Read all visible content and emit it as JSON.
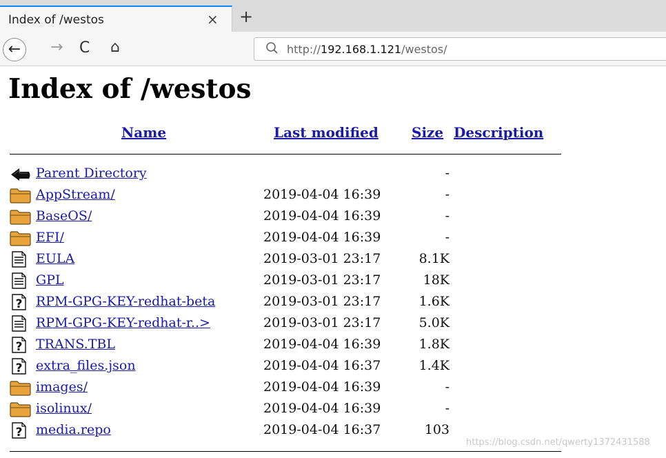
{
  "browser": {
    "tab_title": "Index of /westos",
    "tab_close": "×",
    "new_tab": "+",
    "back": "←",
    "forward": "→",
    "reload": "C",
    "home": "⌂",
    "url_prefix": "http://",
    "url_host": "192.168.1.121",
    "url_path": "/westos/"
  },
  "page": {
    "title": "Index of /westos",
    "columns": [
      "Name",
      "Last modified",
      "Size",
      "Description"
    ],
    "rows": [
      {
        "icon": "back-arrow-icon",
        "name": "Parent Directory",
        "modified": "",
        "size": "-"
      },
      {
        "icon": "folder-icon",
        "name": "AppStream/",
        "modified": "2019-04-04 16:39",
        "size": "-"
      },
      {
        "icon": "folder-icon",
        "name": "BaseOS/",
        "modified": "2019-04-04 16:39",
        "size": "-"
      },
      {
        "icon": "folder-icon",
        "name": "EFI/",
        "modified": "2019-04-04 16:39",
        "size": "-"
      },
      {
        "icon": "text-file-icon",
        "name": "EULA",
        "modified": "2019-03-01 23:17",
        "size": "8.1K"
      },
      {
        "icon": "text-file-icon",
        "name": "GPL",
        "modified": "2019-03-01 23:17",
        "size": "18K"
      },
      {
        "icon": "unknown-file-icon",
        "name": "RPM-GPG-KEY-redhat-beta",
        "modified": "2019-03-01 23:17",
        "size": "1.6K"
      },
      {
        "icon": "text-file-icon",
        "name": "RPM-GPG-KEY-redhat-r..>",
        "modified": "2019-03-01 23:17",
        "size": "5.0K"
      },
      {
        "icon": "unknown-file-icon",
        "name": "TRANS.TBL",
        "modified": "2019-04-04 16:39",
        "size": "1.8K"
      },
      {
        "icon": "unknown-file-icon",
        "name": "extra_files.json",
        "modified": "2019-04-04 16:37",
        "size": "1.4K"
      },
      {
        "icon": "folder-icon",
        "name": "images/",
        "modified": "2019-04-04 16:39",
        "size": "-"
      },
      {
        "icon": "folder-icon",
        "name": "isolinux/",
        "modified": "2019-04-04 16:39",
        "size": "-"
      },
      {
        "icon": "unknown-file-icon",
        "name": "media.repo",
        "modified": "2019-04-04 16:37",
        "size": "103"
      }
    ]
  },
  "watermark": "https://blog.csdn.net/qwerty1372431588",
  "colors": {
    "link": "#1a1aa8",
    "folder": "#e8a43a",
    "tab_accent": "#0a84ff"
  }
}
